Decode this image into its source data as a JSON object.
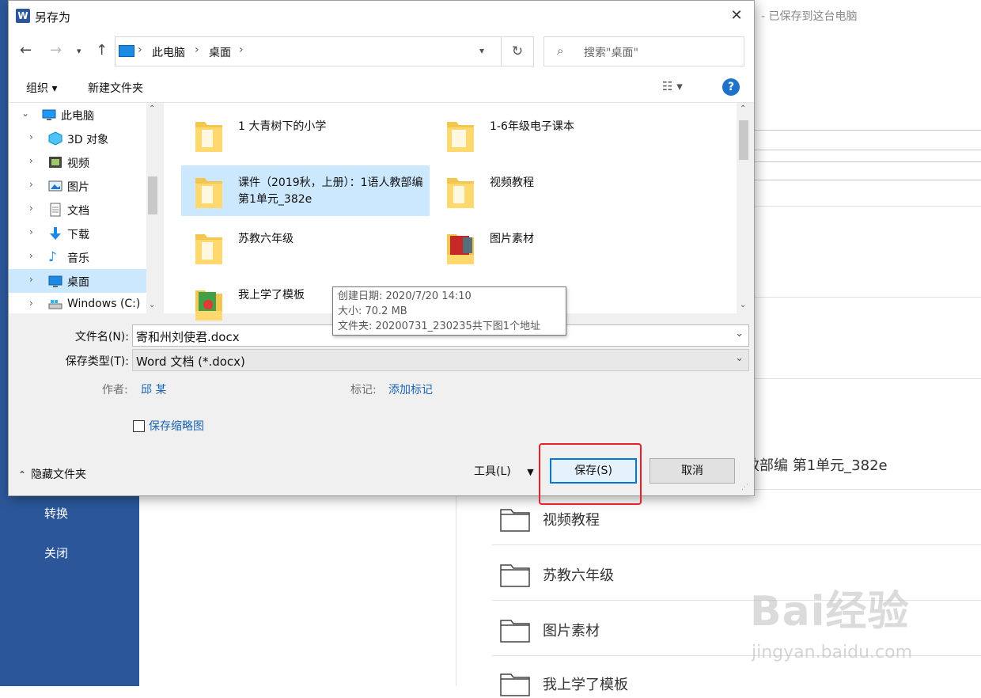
{
  "background": {
    "saved_status": "- 已保存到这台电脑",
    "sidebar_items": [
      "转换",
      "关闭"
    ],
    "partial_title": "效部编 第1单元_382e",
    "folders": [
      "视频教程",
      "苏教六年级",
      "图片素材",
      "我上学了模板"
    ],
    "watermark": "Bai经验",
    "watermark_sub": "jingyan.baidu.com"
  },
  "dialog": {
    "title": "另存为",
    "app_icon_letter": "W",
    "close": "✕",
    "breadcrumb": [
      "此电脑",
      "桌面"
    ],
    "search_placeholder": "搜索\"桌面\"",
    "toolbar": {
      "organize": "组织 ▾",
      "new_folder": "新建文件夹",
      "help": "?"
    },
    "tree": [
      {
        "label": "此电脑",
        "icon": "computer-icon"
      },
      {
        "label": "3D 对象",
        "icon": "cube-icon"
      },
      {
        "label": "视频",
        "icon": "video-icon"
      },
      {
        "label": "图片",
        "icon": "picture-icon"
      },
      {
        "label": "文档",
        "icon": "document-icon"
      },
      {
        "label": "下载",
        "icon": "download-icon"
      },
      {
        "label": "音乐",
        "icon": "music-icon"
      },
      {
        "label": "桌面",
        "icon": "desktop-icon",
        "selected": true
      },
      {
        "label": "Windows (C:)",
        "icon": "drive-icon"
      }
    ],
    "files": [
      {
        "name": "1 大青树下的小学"
      },
      {
        "name": "1-6年级电子课本"
      },
      {
        "name": "课件（2019秋，上册）：1语人教部编 第1单元_382e",
        "selected": true
      },
      {
        "name": "视频教程"
      },
      {
        "name": "苏教六年级"
      },
      {
        "name": "图片素材"
      },
      {
        "name": "我上学了模板"
      }
    ],
    "tooltip": {
      "created": "创建日期: 2020/7/20 14:10",
      "size": "大小: 70.2 MB",
      "folder": "文件夹: 20200731_230235共下图1个地址"
    },
    "form": {
      "filename_label": "文件名(N):",
      "filename_value": "寄和州刘使君.docx",
      "type_label": "保存类型(T):",
      "type_value": "Word 文档 (*.docx)",
      "author_label": "作者:",
      "author_value": "邱 某",
      "tags_label": "标记:",
      "tags_value": "添加标记",
      "thumbnail_label": "保存缩略图"
    },
    "buttons": {
      "hide_folders": "隐藏文件夹",
      "tools": "工具(L)",
      "save": "保存(S)",
      "cancel": "取消"
    }
  }
}
